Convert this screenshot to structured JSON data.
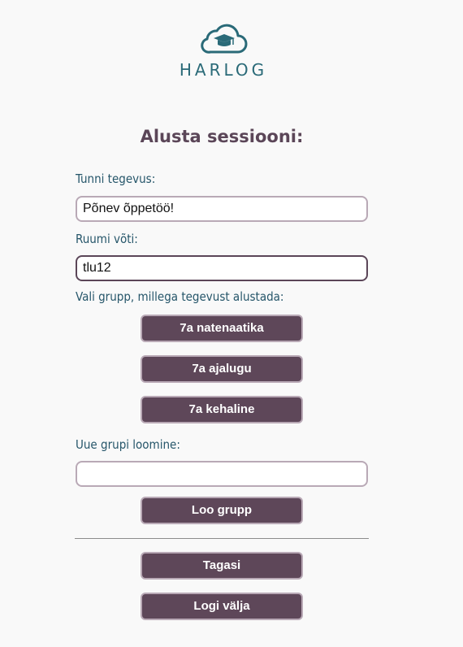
{
  "brand": {
    "name": "HARLOG",
    "icon": "cloud-graduation-cap-icon",
    "color": "#2a6a78"
  },
  "page": {
    "title": "Alusta sessiooni:"
  },
  "form": {
    "activity_label": "Tunni tegevus:",
    "activity_value": "Põnev õppetöö!",
    "room_key_label": "Ruumi võti:",
    "room_key_value": "tlu12",
    "choose_group_label": "Vali grupp, millega tegevust alustada:",
    "groups": [
      "7a natenaatika",
      "7a ajalugu",
      "7a kehaline"
    ],
    "new_group_label": "Uue grupi loomine:",
    "new_group_value": "",
    "create_group_button": "Loo grupp"
  },
  "footer": {
    "back_button": "Tagasi",
    "logout_button": "Logi välja"
  },
  "colors": {
    "accent": "#5e4759",
    "label_text": "#26566a",
    "background": "#f9f9f9"
  }
}
